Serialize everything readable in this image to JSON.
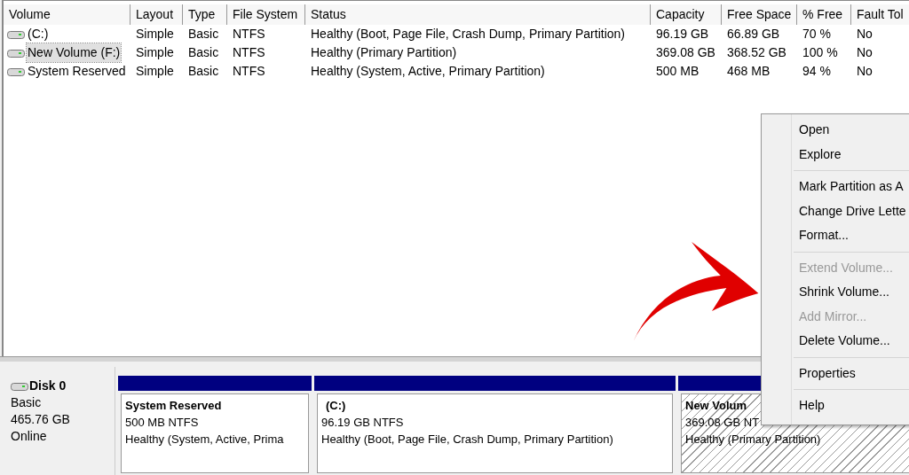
{
  "table": {
    "columns": [
      "Volume",
      "Layout",
      "Type",
      "File System",
      "Status",
      "Capacity",
      "Free Space",
      "% Free",
      "Fault Tol"
    ],
    "rows": [
      {
        "selected": false,
        "cells": [
          "(C:)",
          "Simple",
          "Basic",
          "NTFS",
          "Healthy (Boot, Page File, Crash Dump, Primary Partition)",
          "96.19 GB",
          "66.89 GB",
          "70 %",
          "No"
        ]
      },
      {
        "selected": true,
        "cells": [
          "New Volume (F:)",
          "Simple",
          "Basic",
          "NTFS",
          "Healthy (Primary Partition)",
          "369.08 GB",
          "368.52 GB",
          "100 %",
          "No"
        ]
      },
      {
        "selected": false,
        "cells": [
          "System Reserved",
          "Simple",
          "Basic",
          "NTFS",
          "Healthy (System, Active, Primary Partition)",
          "500 MB",
          "468 MB",
          "94 %",
          "No"
        ]
      }
    ]
  },
  "disk": {
    "name": "Disk 0",
    "type": "Basic",
    "size": "465.76 GB",
    "status": "Online"
  },
  "partitions": [
    {
      "name": "System Reserved",
      "size": "500 MB NTFS",
      "status": "Healthy (System, Active, Prima",
      "selected": false
    },
    {
      "name": "(C:)",
      "size": "96.19 GB NTFS",
      "status": "Healthy (Boot, Page File, Crash Dump, Primary Partition)",
      "selected": false
    },
    {
      "name": "New Volum",
      "size": "369.08 GB NT",
      "status": "Healthy (Primary Partition)",
      "selected": true
    }
  ],
  "context_menu": [
    {
      "kind": "item",
      "label": "Open",
      "disabled": false
    },
    {
      "kind": "item",
      "label": "Explore",
      "disabled": false
    },
    {
      "kind": "separator"
    },
    {
      "kind": "item",
      "label": "Mark Partition as A",
      "disabled": false
    },
    {
      "kind": "item",
      "label": "Change Drive Lette",
      "disabled": false
    },
    {
      "kind": "item",
      "label": "Format...",
      "disabled": false
    },
    {
      "kind": "separator"
    },
    {
      "kind": "item",
      "label": "Extend Volume...",
      "disabled": true
    },
    {
      "kind": "item",
      "label": "Shrink Volume...",
      "disabled": false
    },
    {
      "kind": "item",
      "label": "Add Mirror...",
      "disabled": true
    },
    {
      "kind": "item",
      "label": "Delete Volume...",
      "disabled": false
    },
    {
      "kind": "separator"
    },
    {
      "kind": "item",
      "label": "Properties",
      "disabled": false
    },
    {
      "kind": "separator"
    },
    {
      "kind": "item",
      "label": "Help",
      "disabled": false
    }
  ]
}
